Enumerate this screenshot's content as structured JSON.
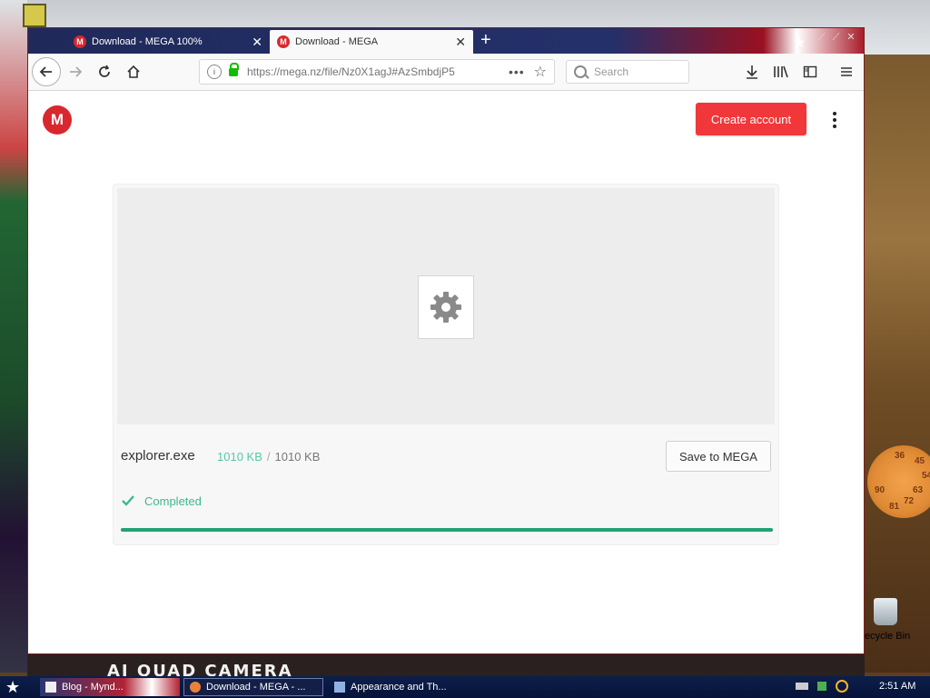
{
  "browser": {
    "tabs": [
      {
        "title": "Download - MEGA 100%",
        "favicon": "M",
        "active": false
      },
      {
        "title": "Download - MEGA",
        "favicon": "M",
        "active": true
      }
    ],
    "close_glyph": "✕",
    "new_tab_glyph": "+",
    "url": "https://mega.nz/file/Nz0X1agJ#AzSmbdjP5",
    "url_more": "•••",
    "search_placeholder": "Search"
  },
  "page": {
    "logo_letter": "M",
    "create_account_label": "Create account",
    "file": {
      "name": "explorer.exe",
      "downloaded": "1010 KB",
      "separator": "/",
      "total": "1010 KB"
    },
    "save_label": "Save to MEGA",
    "status_text": "Completed",
    "progress_fraction": 1.0
  },
  "desktop": {
    "camera_text": "AI QUAD CAMERA",
    "recycle_label": "ecycle Bin",
    "dart_numbers": [
      "36",
      "45",
      "54",
      "63",
      "72",
      "81",
      "90"
    ]
  },
  "taskbar": {
    "items": [
      {
        "label": "Blog - Mynd..."
      },
      {
        "label": "Download - MEGA - ..."
      },
      {
        "label": "Appearance and Th..."
      }
    ],
    "clock": "2:51 AM"
  },
  "colors": {
    "mega_red": "#d9272e",
    "create_btn": "#f0373a",
    "complete_green": "#3bba8c",
    "progress_green": "#21a272"
  }
}
